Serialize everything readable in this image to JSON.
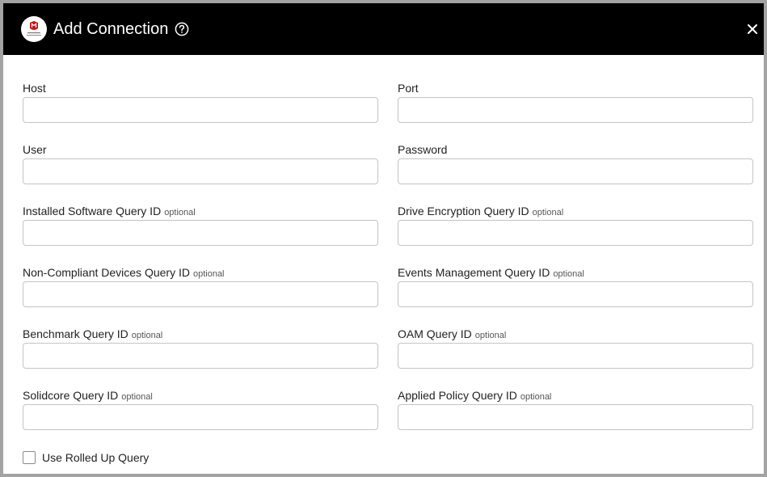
{
  "header": {
    "title": "Add Connection",
    "logo_text": "TRELLIX EPO",
    "logo_color": "#c01818",
    "background": "#000000"
  },
  "fields": [
    {
      "label": "Host",
      "optional": "",
      "value": ""
    },
    {
      "label": "Port",
      "optional": "",
      "value": ""
    },
    {
      "label": "User",
      "optional": "",
      "value": ""
    },
    {
      "label": "Password",
      "optional": "",
      "value": ""
    },
    {
      "label": "Installed Software Query ID",
      "optional": "optional",
      "value": ""
    },
    {
      "label": "Drive Encryption Query ID",
      "optional": "optional",
      "value": ""
    },
    {
      "label": "Non-Compliant Devices Query ID",
      "optional": "optional",
      "value": ""
    },
    {
      "label": "Events Management Query ID",
      "optional": "optional",
      "value": ""
    },
    {
      "label": "Benchmark Query ID",
      "optional": "optional",
      "value": ""
    },
    {
      "label": "OAM Query ID",
      "optional": "optional",
      "value": ""
    },
    {
      "label": "Solidcore Query ID",
      "optional": "optional",
      "value": ""
    },
    {
      "label": "Applied Policy Query ID",
      "optional": "optional",
      "value": ""
    }
  ],
  "checkbox": {
    "label": "Use Rolled Up Query",
    "checked": false
  },
  "icons": {
    "help": "help-circle-icon",
    "close": "close-icon"
  }
}
